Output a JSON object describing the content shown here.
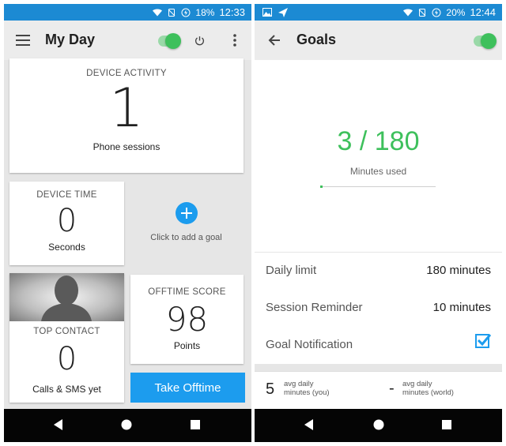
{
  "left": {
    "status": {
      "battery": "18%",
      "time": "12:33"
    },
    "appbar": {
      "title": "My Day"
    },
    "device_activity": {
      "title": "DEVICE ACTIVITY",
      "value": "1",
      "label": "Phone sessions"
    },
    "device_time": {
      "title": "DEVICE TIME",
      "value": "0",
      "label": "Seconds"
    },
    "add_goal": {
      "label": "Click to add a goal"
    },
    "top_contact": {
      "title": "TOP CONTACT",
      "value": "0",
      "label": "Calls & SMS yet"
    },
    "offtime_score": {
      "title": "OFFTIME SCORE",
      "value": "98",
      "label": "Points"
    },
    "take_offtime": {
      "label": "Take Offtime"
    }
  },
  "right": {
    "status": {
      "battery": "20%",
      "time": "12:44"
    },
    "appbar": {
      "title": "Goals"
    },
    "usage": {
      "value": "3 / 180",
      "label": "Minutes used",
      "progress": 0.0167
    },
    "rows": [
      {
        "label": "Daily limit",
        "value": "180 minutes"
      },
      {
        "label": "Session Reminder",
        "value": "10 minutes"
      },
      {
        "label": "Goal Notification",
        "checked": true
      }
    ],
    "averages": {
      "you": {
        "value": "5",
        "label_line1": "avg daily",
        "label_line2": "minutes (you)"
      },
      "world": {
        "value": "-",
        "label_line1": "avg daily",
        "label_line2": "minutes (world)"
      }
    }
  },
  "colors": {
    "status_bar": "#1c8ad3",
    "accent_green": "#3ec05c",
    "accent_blue": "#1c9cee",
    "nav_bar": "#050505"
  },
  "icons": [
    "wifi-icon",
    "no-sim-icon",
    "battery-icon",
    "menu-icon",
    "power-icon",
    "more-vert-icon",
    "back-arrow-icon",
    "add-icon",
    "image-icon",
    "send-icon",
    "check-icon",
    "nav-back-icon",
    "nav-home-icon",
    "nav-recents-icon"
  ]
}
